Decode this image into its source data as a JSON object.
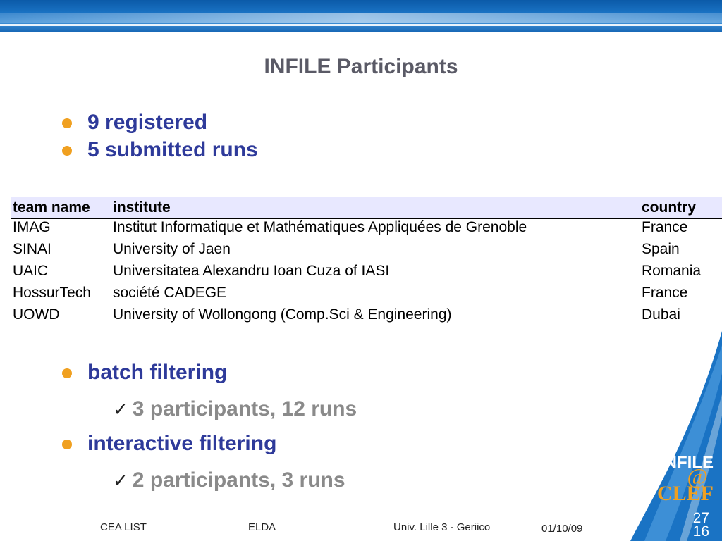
{
  "title": "INFILE Participants",
  "bullets_top": [
    "9 registered",
    "5 submitted runs"
  ],
  "table": {
    "headers": [
      "team name",
      "institute",
      "country"
    ],
    "rows": [
      [
        "IMAG",
        "Institut Informatique et Mathématiques Appliquées de Grenoble",
        "France"
      ],
      [
        "SINAI",
        "University of Jaen",
        "Spain"
      ],
      [
        "UAIC",
        "Universitatea Alexandru Ioan Cuza of IASI",
        "Romania"
      ],
      [
        "HossurTech",
        "société CADEGE",
        "France"
      ],
      [
        "UOWD",
        "University of Wollongong (Comp.Sci & Engineering)",
        "Dubai"
      ]
    ]
  },
  "bullets_bottom": [
    {
      "label": "batch filtering",
      "sub": "3 participants, 12 runs"
    },
    {
      "label": "interactive filtering",
      "sub": "2 participants, 3 runs"
    }
  ],
  "logo": {
    "line1": "INFILE",
    "at": "@",
    "line3": "CLEF"
  },
  "footer": {
    "left": "CEA LIST",
    "mid": "ELDA",
    "right": "Univ. Lille 3 - Geriico",
    "date": "01/10/09"
  },
  "page": {
    "total": "27",
    "current": "16"
  },
  "colors": {
    "bullet_text": "#2e3a9a",
    "bullet_dot": "#f0a020",
    "sub_text": "#8a8a8a",
    "header_bg": "#e8e8ff",
    "band": "#1a73c4"
  }
}
